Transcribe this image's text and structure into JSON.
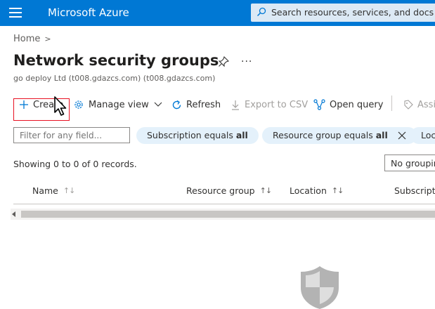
{
  "topbar": {
    "brand": "Microsoft Azure",
    "search_placeholder": "Search resources, services, and docs (G",
    "color": "#0078d4"
  },
  "breadcrumb": {
    "home": "Home"
  },
  "page": {
    "title": "Network security groups",
    "subtitle": "go deploy Ltd (t008.gdazcs.com) (t008.gdazcs.com)"
  },
  "toolbar": {
    "create": "Create",
    "manage_view": "Manage view",
    "refresh": "Refresh",
    "export_csv": "Export to CSV",
    "open_query": "Open query",
    "assign_tags": "Assi"
  },
  "filters": {
    "input_placeholder": "Filter for any field...",
    "subscription_prefix": "Subscription equals ",
    "subscription_value": "all",
    "resource_group_prefix": "Resource group equals ",
    "resource_group_value": "all",
    "location_pill": "Loc"
  },
  "records_text": "Showing 0 to 0 of 0 records.",
  "grouping_value": "No groupin",
  "columns": {
    "name": "Name",
    "resource_group": "Resource group",
    "location": "Location",
    "subscription": "Subscripti"
  }
}
